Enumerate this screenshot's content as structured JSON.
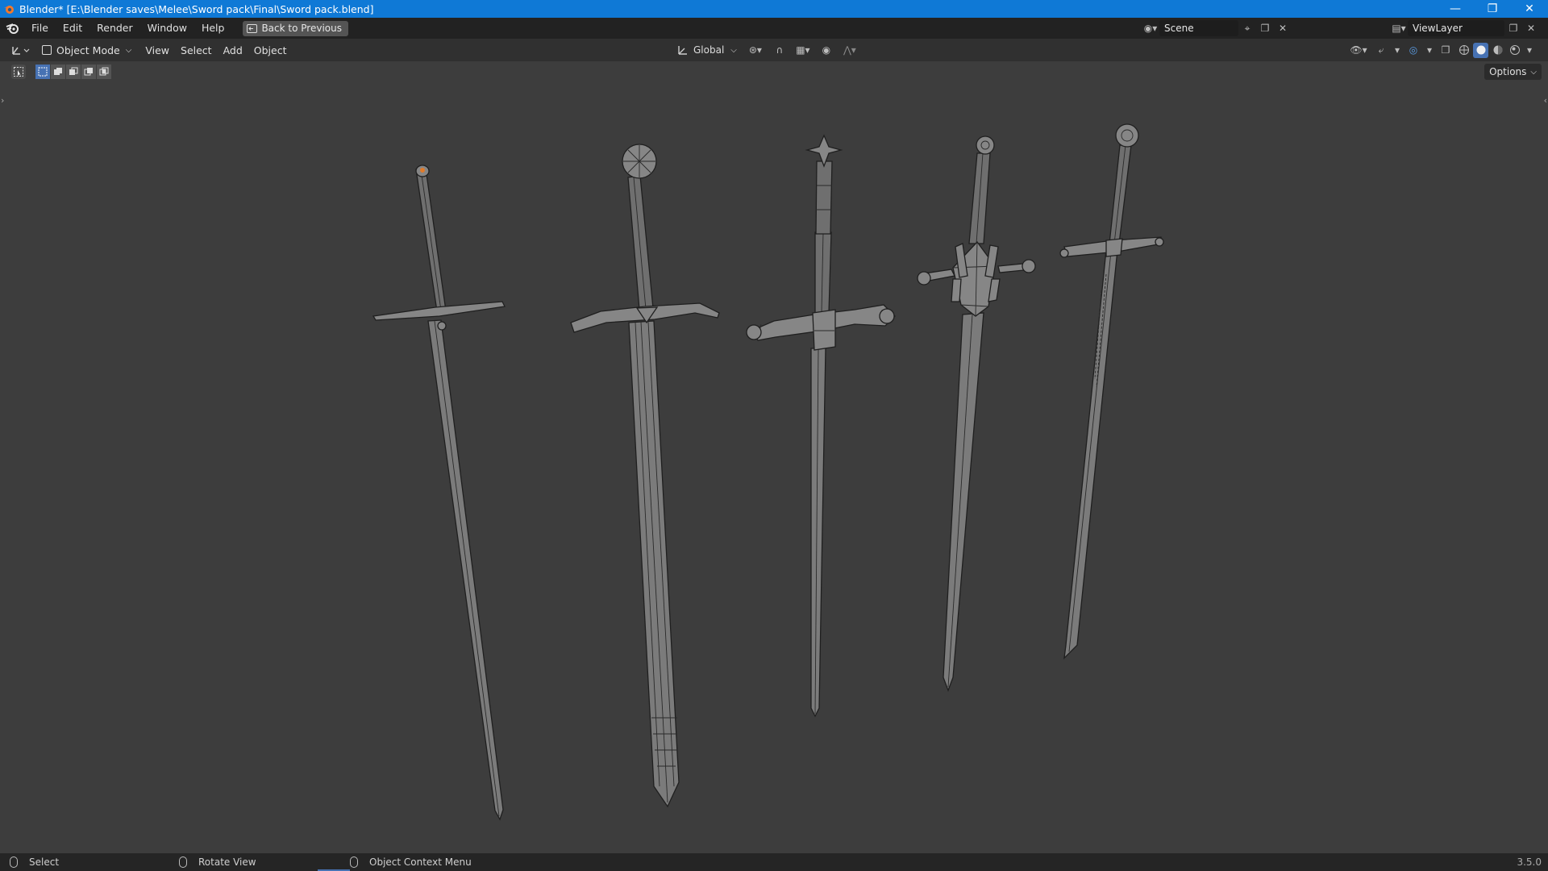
{
  "window": {
    "title": "Blender* [E:\\Blender saves\\Melee\\Sword pack\\Final\\Sword pack.blend]",
    "minimize_icon": "minimize-icon",
    "maximize_icon": "restore-icon",
    "close_icon": "close-icon"
  },
  "menubar": {
    "items": [
      "File",
      "Edit",
      "Render",
      "Window",
      "Help"
    ],
    "back_label": "Back to Previous",
    "scene_name": "Scene",
    "view_layer_name": "ViewLayer"
  },
  "viewport_header": {
    "mode": "Object Mode",
    "menus": [
      "View",
      "Select",
      "Add",
      "Object"
    ],
    "transform_orientation": "Global"
  },
  "tool_row": {
    "options_label": "Options"
  },
  "statusbar": {
    "select": "Select",
    "rotate": "Rotate View",
    "context_menu": "Object Context Menu",
    "version": "3.5.0"
  },
  "colors": {
    "titlebar": "#0f79d6",
    "viewport_bg": "#3d3d3d",
    "accent": "#4772b3",
    "sword_fill": "#7a7a7a"
  },
  "viewport_objects": [
    "sword-1",
    "sword-2",
    "sword-3",
    "sword-4",
    "sword-5"
  ]
}
